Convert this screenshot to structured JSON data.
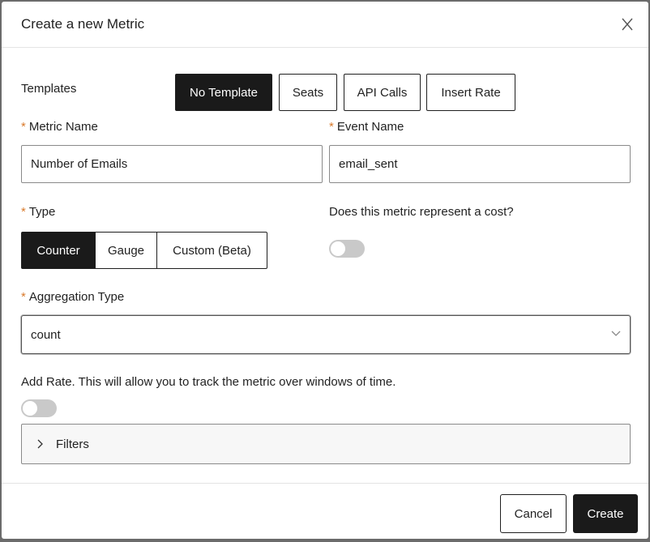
{
  "modal": {
    "title": "Create a new Metric",
    "close_icon": "close-icon"
  },
  "templates": {
    "label": "Templates",
    "options": [
      "No Template",
      "Seats",
      "API Calls",
      "Insert Rate"
    ],
    "selected": "No Template"
  },
  "metric_name": {
    "required_marker": "*",
    "label": "Metric Name",
    "value": "Number of Emails"
  },
  "event_name": {
    "required_marker": "*",
    "label": "Event Name",
    "value": "email_sent"
  },
  "type": {
    "required_marker": "*",
    "label": "Type",
    "options": [
      "Counter",
      "Gauge",
      "Custom (Beta)"
    ],
    "selected": "Counter"
  },
  "cost": {
    "label": "Does this metric represent a cost?",
    "enabled": false
  },
  "aggregation": {
    "required_marker": "*",
    "label": "Aggregation Type",
    "value": "count",
    "icon": "chevron-down-icon"
  },
  "rate": {
    "label": "Add Rate. This will allow you to track the metric over windows of time.",
    "enabled": false
  },
  "filters": {
    "label": "Filters",
    "icon": "chevron-right-icon",
    "expanded": false
  },
  "footer": {
    "cancel_label": "Cancel",
    "create_label": "Create"
  },
  "colors": {
    "primary": "#1a1a1a",
    "required": "#d97a2b",
    "toggle_off": "#c9c9c9"
  }
}
